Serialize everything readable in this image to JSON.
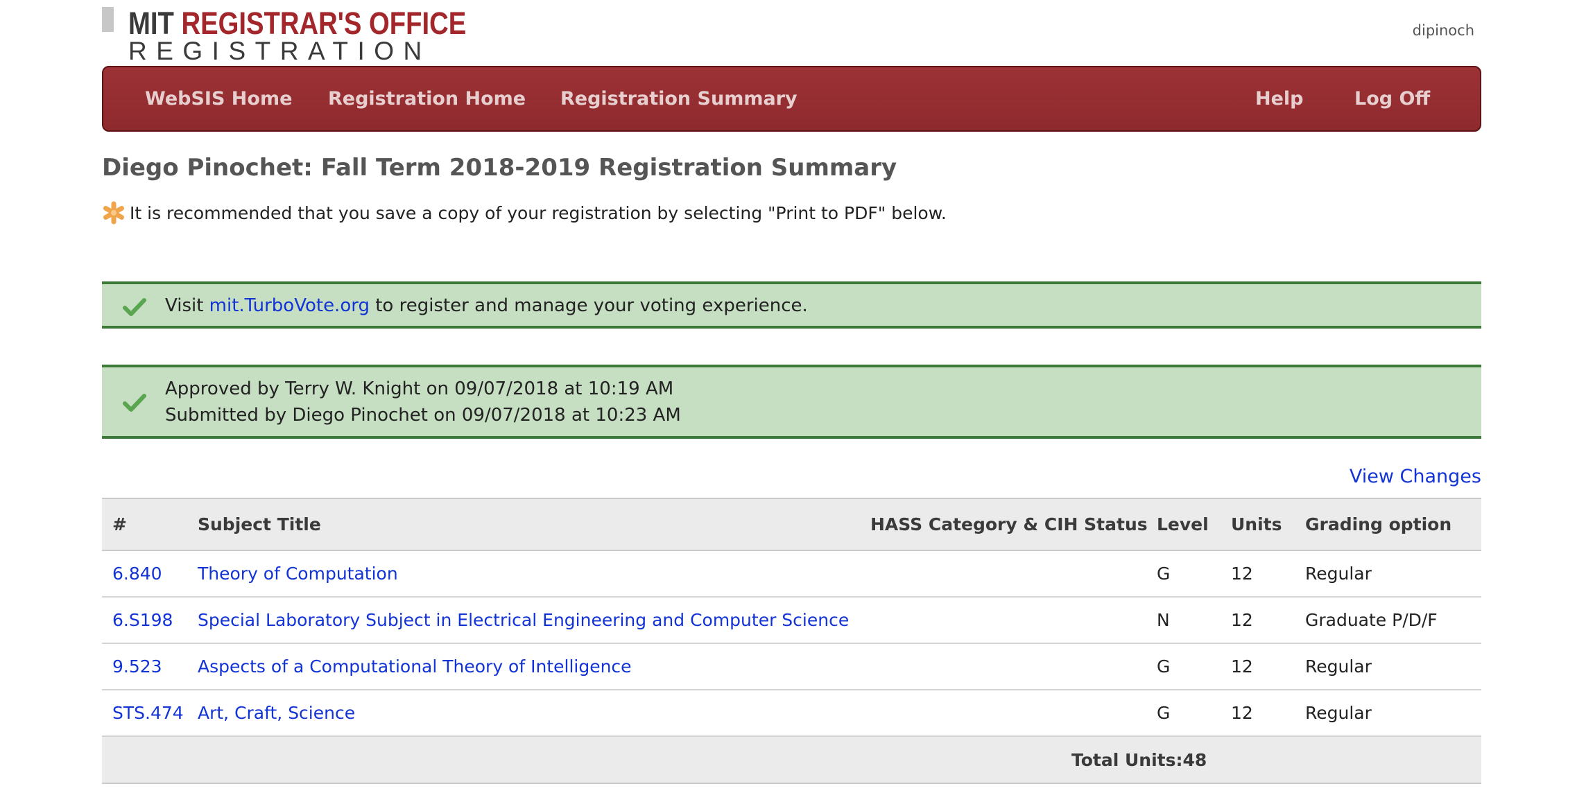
{
  "header": {
    "logo_line1_a": "MIT ",
    "logo_line1_b": "REGISTRAR'S OFFICE",
    "logo_line2": "REGISTRATION",
    "username": "dipinoch"
  },
  "nav": {
    "items": [
      {
        "label": "WebSIS Home"
      },
      {
        "label": "Registration Home"
      },
      {
        "label": "Registration Summary"
      },
      {
        "label": "Help"
      },
      {
        "label": "Log Off"
      }
    ]
  },
  "page": {
    "title": "Diego Pinochet: Fall Term 2018-2019 Registration Summary",
    "recommendation": "It is recommended that you save a copy of your registration by selecting \"Print to PDF\" below."
  },
  "alerts": {
    "vote_prefix": "Visit ",
    "vote_link": "mit.TurboVote.org",
    "vote_suffix": " to register and manage your voting experience.",
    "approved": "Approved by Terry W. Knight on 09/07/2018 at 10:19 AM",
    "submitted": "Submitted by Diego Pinochet on 09/07/2018 at 10:23 AM"
  },
  "view_changes": "View Changes",
  "table": {
    "headers": [
      "#",
      "Subject Title",
      "HASS Category & CIH Status",
      "Level",
      "Units",
      "Grading option"
    ],
    "rows": [
      {
        "num": "6.840",
        "title": "Theory of Computation",
        "hass": "",
        "level": "G",
        "units": "12",
        "grading": "Regular"
      },
      {
        "num": "6.S198",
        "title": "Special Laboratory Subject in Electrical Engineering and Computer Science",
        "hass": "",
        "level": "N",
        "units": "12",
        "grading": "Graduate P/D/F"
      },
      {
        "num": "9.523",
        "title": "Aspects of a Computational Theory of Intelligence",
        "hass": "",
        "level": "G",
        "units": "12",
        "grading": "Regular"
      },
      {
        "num": "STS.474",
        "title": "Art, Craft, Science",
        "hass": "",
        "level": "G",
        "units": "12",
        "grading": "Regular"
      }
    ],
    "total": "Total Units:48"
  },
  "colors": {
    "nav_bg": "#9c3235",
    "logo_red": "#a3262b",
    "alert_bg": "#c6dfc2",
    "alert_border": "#3d7a3a",
    "link": "#1234d6"
  },
  "icons": {
    "recommend": "asterisk-icon",
    "alert": "check-icon"
  }
}
